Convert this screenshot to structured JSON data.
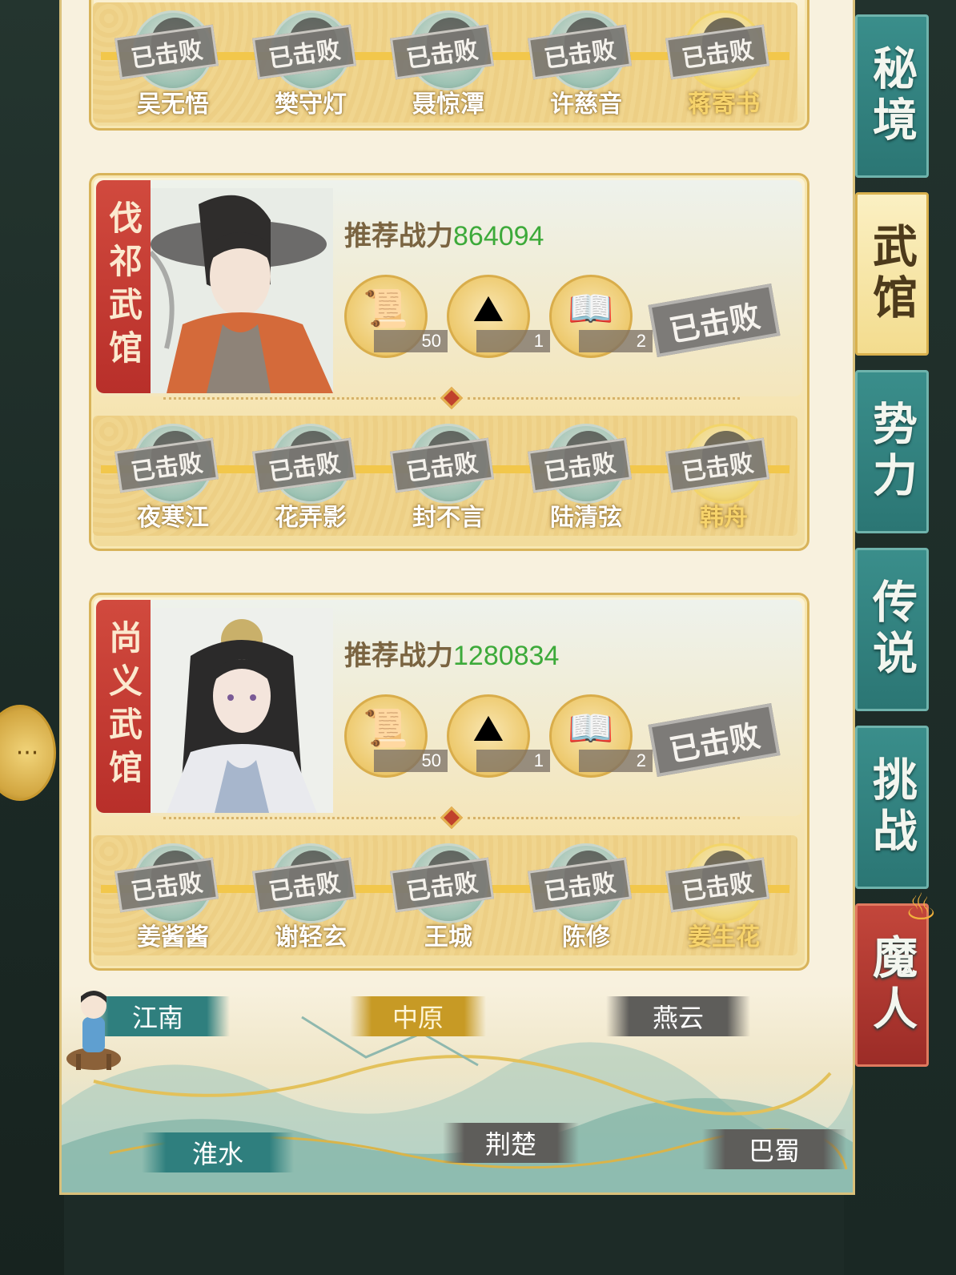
{
  "top_card": {
    "members": [
      {
        "name": "吴无悟",
        "status": "已击败",
        "gold": false
      },
      {
        "name": "樊守灯",
        "status": "已击败",
        "gold": false
      },
      {
        "name": "聂惊潭",
        "status": "已击败",
        "gold": false
      },
      {
        "name": "许慈音",
        "status": "已击败",
        "gold": false
      },
      {
        "name": "蒋寄书",
        "status": "已击败",
        "gold": true
      }
    ]
  },
  "halls": [
    {
      "name": "伐祁武馆",
      "power_label": "推荐战力",
      "power_value": "864094",
      "rewards": [
        {
          "icon": "scroll-icon",
          "count": "50"
        },
        {
          "icon": "powder-icon",
          "count": "1"
        },
        {
          "icon": "book-icon",
          "count": "2"
        }
      ],
      "status": "已击败",
      "members": [
        {
          "name": "夜寒江",
          "status": "已击败",
          "gold": false
        },
        {
          "name": "花弄影",
          "status": "已击败",
          "gold": false
        },
        {
          "name": "封不言",
          "status": "已击败",
          "gold": false
        },
        {
          "name": "陆清弦",
          "status": "已击败",
          "gold": false
        },
        {
          "name": "韩舟",
          "status": "已击败",
          "gold": true
        }
      ]
    },
    {
      "name": "尚义武馆",
      "power_label": "推荐战力",
      "power_value": "1280834",
      "rewards": [
        {
          "icon": "scroll-icon",
          "count": "50"
        },
        {
          "icon": "powder-icon",
          "count": "1"
        },
        {
          "icon": "book-icon",
          "count": "2"
        }
      ],
      "status": "已击败",
      "members": [
        {
          "name": "姜酱酱",
          "status": "已击败",
          "gold": false
        },
        {
          "name": "谢轻玄",
          "status": "已击败",
          "gold": false
        },
        {
          "name": "王城",
          "status": "已击败",
          "gold": false
        },
        {
          "name": "陈修",
          "status": "已击败",
          "gold": false
        },
        {
          "name": "姜生花",
          "status": "已击败",
          "gold": true
        }
      ]
    }
  ],
  "map": {
    "regions": [
      {
        "name": "江南",
        "style": "teal"
      },
      {
        "name": "中原",
        "style": "gold"
      },
      {
        "name": "燕云",
        "style": "grey"
      },
      {
        "name": "淮水",
        "style": "teal"
      },
      {
        "name": "荆楚",
        "style": "grey"
      },
      {
        "name": "巴蜀",
        "style": "grey"
      }
    ]
  },
  "tabs": [
    {
      "label": "秘境",
      "state": "normal"
    },
    {
      "label": "武馆",
      "state": "active"
    },
    {
      "label": "势力",
      "state": "normal"
    },
    {
      "label": "传说",
      "state": "normal"
    },
    {
      "label": "挑战",
      "state": "normal"
    },
    {
      "label": "魔人",
      "state": "demon"
    }
  ],
  "colors": {
    "power_value": "#3daa3a",
    "tab_teal": "#2f7f7e",
    "hall_tag_red": "#b82f2a",
    "gold_accent": "#c79a25"
  }
}
